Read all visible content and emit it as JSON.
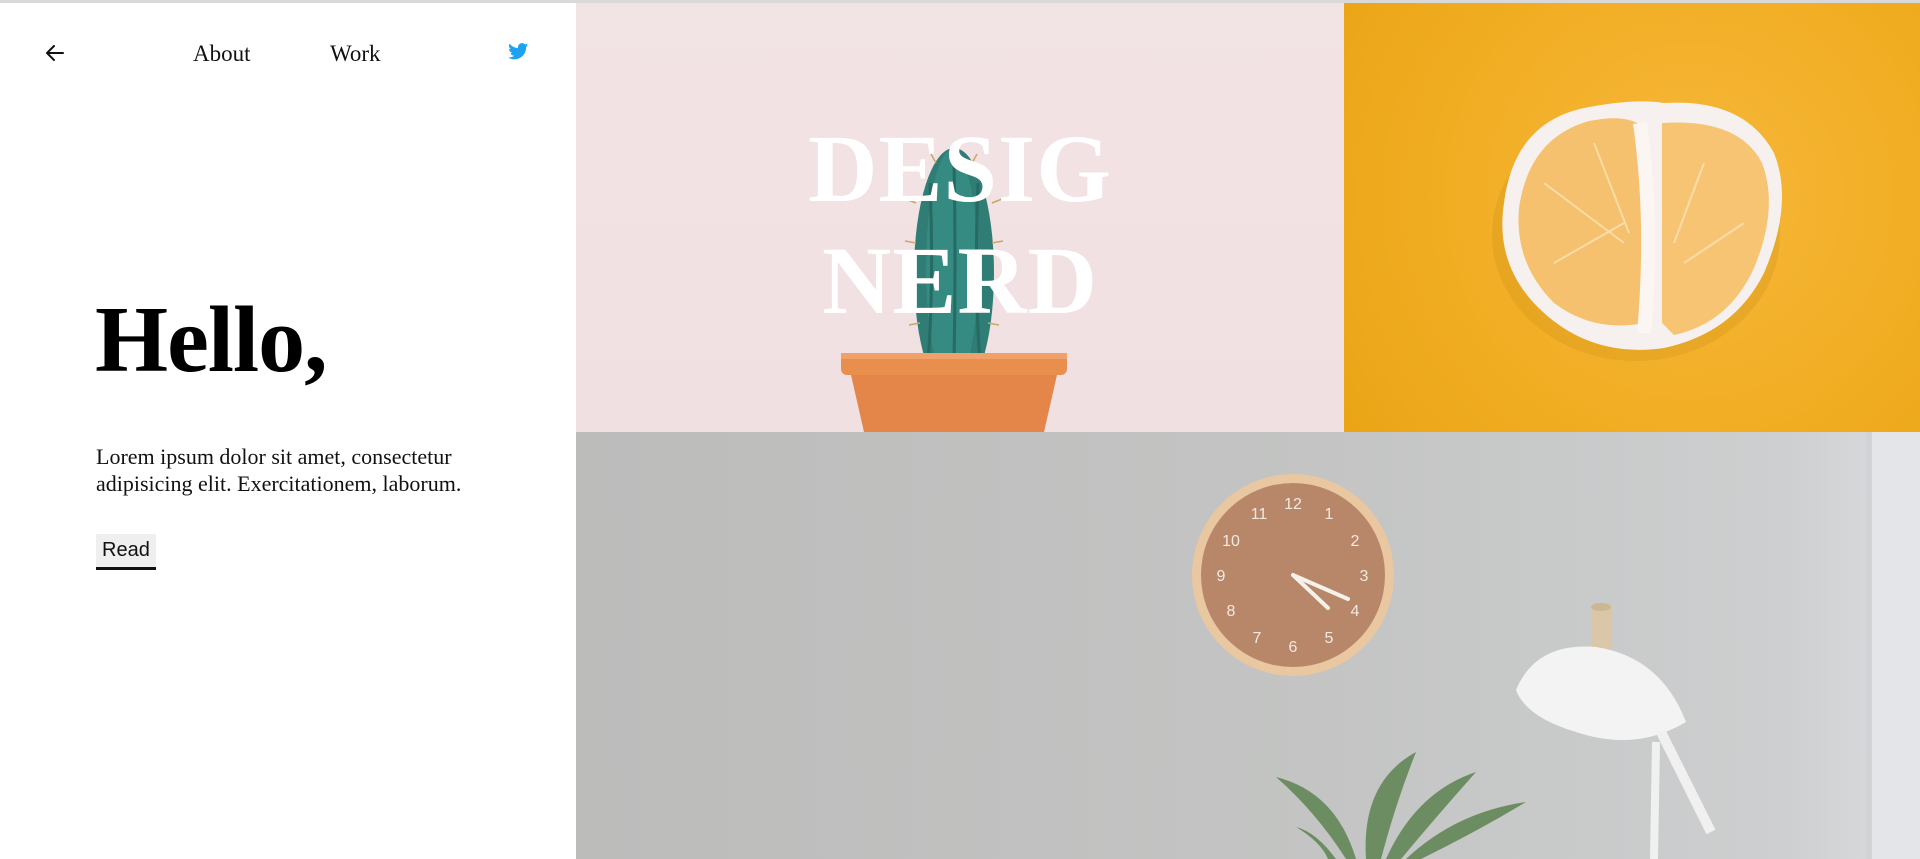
{
  "nav": {
    "back_icon": "arrow-left-icon",
    "links": [
      "About",
      "Work"
    ],
    "twitter_icon": "twitter-icon",
    "twitter_color": "#1da1f2"
  },
  "hero": {
    "heading": "Hello,",
    "body": "Lorem ipsum dolor sit amet, consectetur adipisicing elit. Exercitationem, laborum.",
    "read_label": "Read"
  },
  "gallery": {
    "cactus_title_line1": "DESIG",
    "cactus_title_line2": "NERD"
  }
}
